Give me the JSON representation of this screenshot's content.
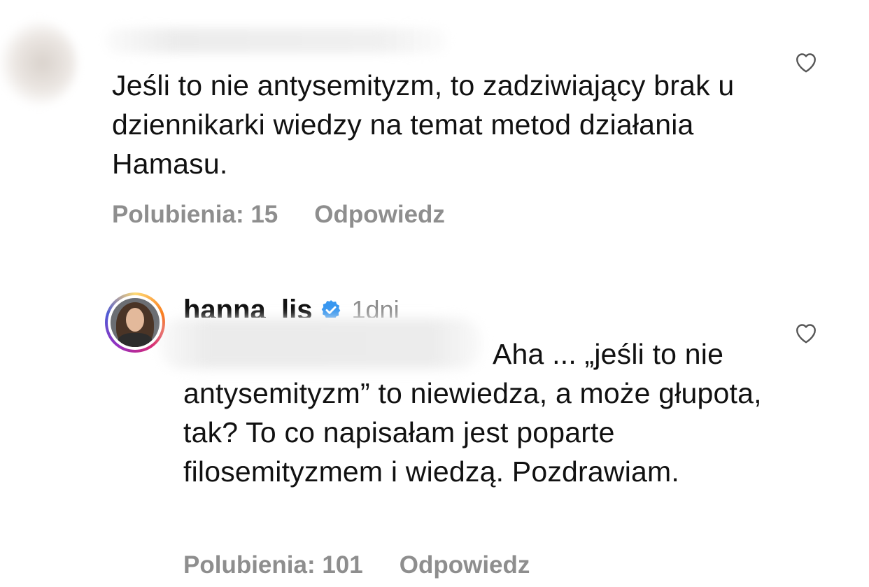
{
  "comments": [
    {
      "text": "Jeśli to nie antysemityzm, to zadziwiający brak u dziennikarki wiedzy na temat metod działania Hamasu.",
      "likes_label": "Polubienia: 15",
      "reply_label": "Odpowiedz",
      "like_icon": "heart-outline-icon"
    },
    {
      "username": "hanna_lis",
      "verified": true,
      "time": "1dni",
      "text": "Aha ... „jeśli to nie antysemityzm” to niewiedza, a może głupota, tak? To co napisałam jest poparte filosemityzmem i wiedzą. Pozdrawiam.",
      "likes_label": "Polubienia: 101",
      "reply_label": "Odpowiedz",
      "like_icon": "heart-outline-icon"
    }
  ],
  "colors": {
    "text": "#111111",
    "meta": "#8e8e8e",
    "verified": "#3897f0"
  }
}
